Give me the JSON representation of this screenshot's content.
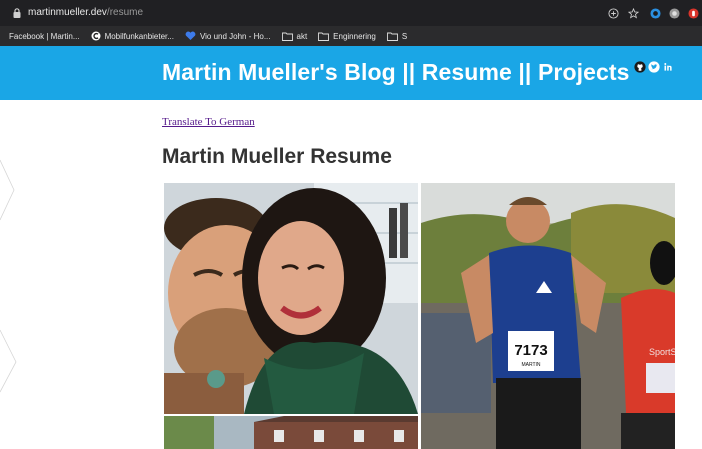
{
  "browser": {
    "url_domain": "martinmueller.dev",
    "url_path": "/resume",
    "bookmarks": [
      {
        "label": "Facebook | Martin...",
        "icon": "facebook-icon"
      },
      {
        "label": "Mobilfunkanbieter...",
        "icon": "c-logo-icon"
      },
      {
        "label": "Vio und John - Ho...",
        "icon": "heart-icon"
      },
      {
        "label": "akt",
        "icon": "folder-icon"
      },
      {
        "label": "Enginnering",
        "icon": "folder-icon"
      },
      {
        "label": "S",
        "icon": "folder-icon"
      }
    ],
    "toolbar_icons": [
      "add-circle-icon",
      "star-icon",
      "extension-icon",
      "profile-icon",
      "shield-icon"
    ]
  },
  "header": {
    "title": "Martin Mueller's Blog || Resume || Projects",
    "background": "#1aa6e6",
    "social_icons": [
      "github-icon",
      "twitter-icon",
      "linkedin-icon"
    ]
  },
  "main": {
    "translate_link": "Translate To German",
    "heading": "Martin Mueller Resume",
    "race_bib_number": "7173",
    "race_bib_name": "MARTIN",
    "race_sponsor": "SportSA"
  }
}
